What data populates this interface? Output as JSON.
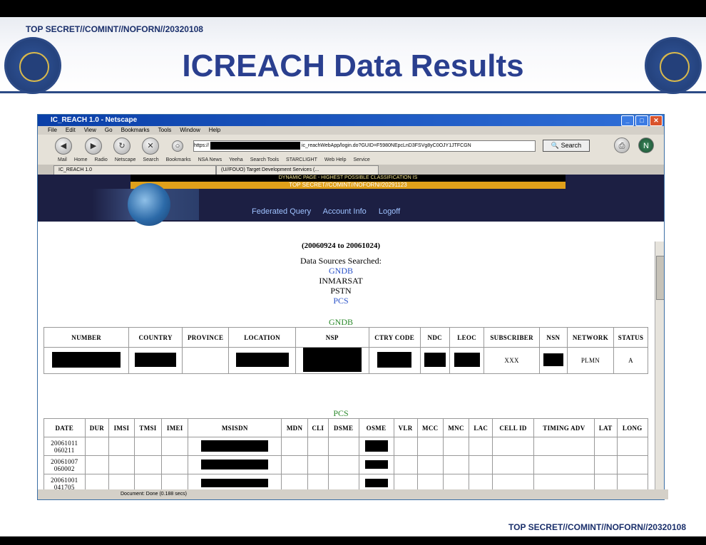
{
  "slide": {
    "classification_top": "TOP SECRET//COMINT//NOFORN//20320108",
    "classification_bottom": "TOP SECRET//COMINT//NOFORN//20320108",
    "title": "ICREACH Data Results",
    "left_seal": "nsa-seal-icon",
    "right_seal": "css-seal-icon"
  },
  "browser": {
    "window_title": "IC_REACH 1.0 - Netscape",
    "menu": [
      "File",
      "Edit",
      "View",
      "Go",
      "Bookmarks",
      "Tools",
      "Window",
      "Help"
    ],
    "url_prefix": "https://",
    "url_suffix": "ic_reachWebApp/login.do?GUID=F5980NEpcLnD3FSVg8yC0OJY1JTFCGN",
    "search_label": "Search",
    "bookmarks": [
      "Mail",
      "Home",
      "Radio",
      "Netscape",
      "Search",
      "Bookmarks",
      "NSA News",
      "Yeeha",
      "Search Tools",
      "STARCLIGHT",
      "Web Help",
      "Service"
    ],
    "tabs": [
      "IC_REACH 1.0",
      "(U//FOUO) Target Development Services (..."
    ],
    "status_text": "Document: Done (0.188 secs)"
  },
  "page": {
    "dynamic_banner": "DYNAMIC PAGE - HIGHEST POSSIBLE CLASSIFICATION IS",
    "dynamic_class": "TOP SECRET//COMINT//NOFORN//20291123",
    "nav": [
      "Federated Query",
      "Account Info",
      "Logoff"
    ],
    "date_range": "(20060924 to 20061024)",
    "sources_label": "Data Sources Searched:",
    "sources": [
      {
        "name": "GNDB",
        "link": true
      },
      {
        "name": "INMARSAT",
        "link": false
      },
      {
        "name": "PSTN",
        "link": false
      },
      {
        "name": "PCS",
        "link": true
      }
    ],
    "gndb": {
      "heading": "GNDB",
      "columns": [
        "NUMBER",
        "COUNTRY",
        "PROVINCE",
        "LOCATION",
        "NSP",
        "CTRY CODE",
        "NDC",
        "LEOC",
        "SUBSCRIBER",
        "NSN",
        "NETWORK",
        "STATUS"
      ],
      "row": {
        "subscriber": "XXX",
        "network": "PLMN",
        "status": "A"
      }
    },
    "pcs": {
      "heading": "PCS",
      "columns": [
        "DATE",
        "DUR",
        "IMSI",
        "TMSI",
        "IMEI",
        "MSISDN",
        "MDN",
        "CLI",
        "DSME",
        "OSME",
        "VLR",
        "MCC",
        "MNC",
        "LAC",
        "CELL ID",
        "TIMING ADV",
        "LAT",
        "LONG"
      ],
      "rows": [
        {
          "date1": "20061011",
          "date2": "060211"
        },
        {
          "date1": "20061007",
          "date2": "060002"
        },
        {
          "date1": "20061001",
          "date2": "041705"
        }
      ]
    }
  }
}
